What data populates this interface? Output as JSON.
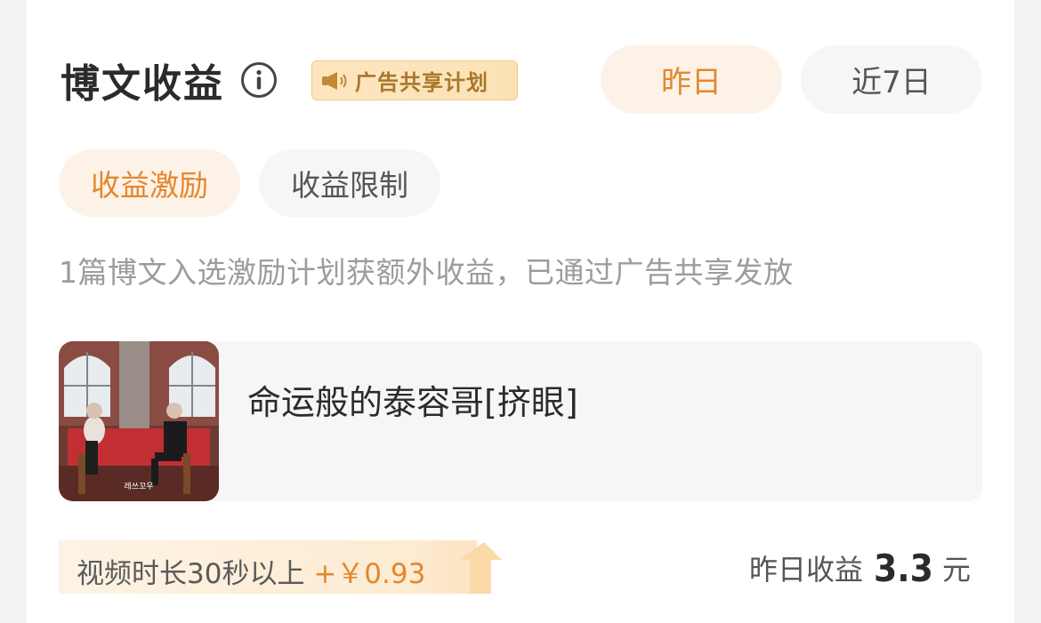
{
  "header": {
    "title": "博文收益",
    "ad_badge": "广告共享计划"
  },
  "range_tabs": [
    {
      "label": "昨日",
      "active": true
    },
    {
      "label": "近7日",
      "active": false
    }
  ],
  "sub_tabs": [
    {
      "label": "收益激励",
      "active": true
    },
    {
      "label": "收益限制",
      "active": false
    }
  ],
  "description": "1篇博文入选激励计划获额外收益，已通过广告共享发放",
  "post": {
    "title": "命运般的泰容哥[挤眼]",
    "thumb_caption": "레쓰꼬우"
  },
  "bonus": {
    "label": "视频时长30秒以上",
    "amount": "+￥0.93"
  },
  "earnings": {
    "label": "昨日收益",
    "value": "3.3",
    "unit": "元"
  },
  "colors": {
    "accent": "#e2882d",
    "accent_bg": "#fdf2e7",
    "badge_text": "#a9772d"
  }
}
